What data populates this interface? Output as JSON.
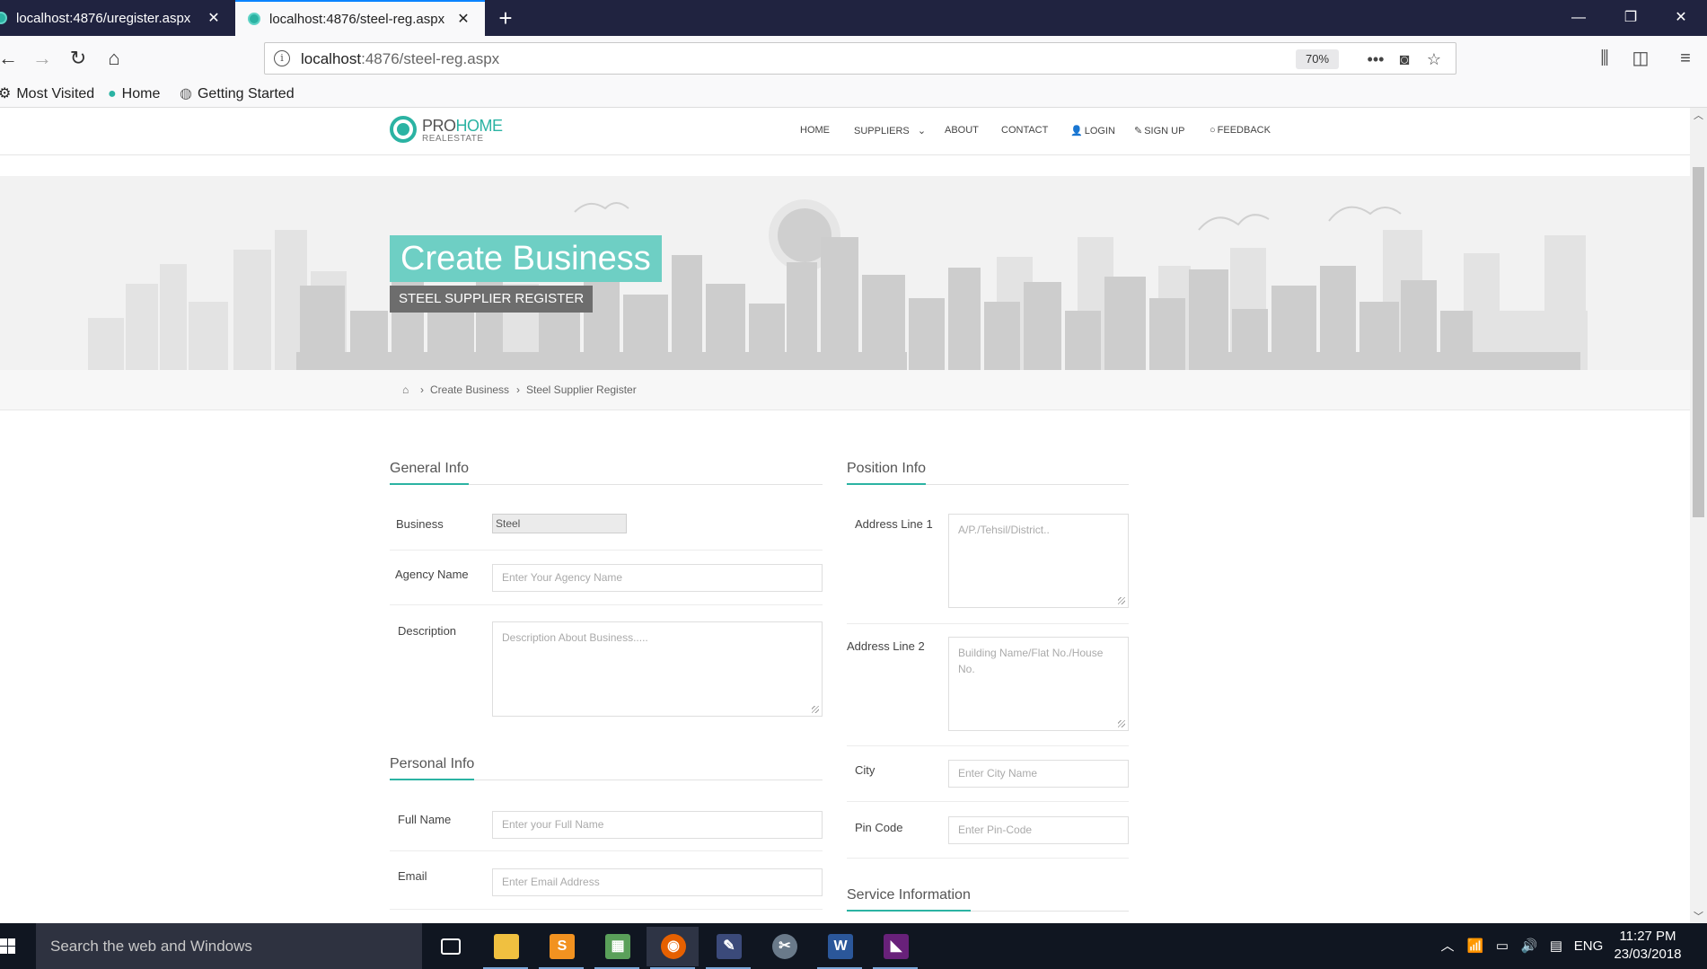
{
  "browser": {
    "tabs": [
      {
        "label": "localhost:4876/uregister.aspx",
        "active": false
      },
      {
        "label": "localhost:4876/steel-reg.aspx",
        "active": true
      }
    ],
    "url_host": "localhost",
    "url_path": ":4876/steel-reg.aspx",
    "zoom": "70%",
    "bookmarks": [
      "Most Visited",
      "Home",
      "Getting Started"
    ]
  },
  "site": {
    "logo_pro": "PRO",
    "logo_home": "HOME",
    "logo_sub": "REALESTATE",
    "menu": {
      "home": "HOME",
      "suppliers": "SUPPLIERS",
      "about": "ABOUT",
      "contact": "CONTACT",
      "login": "LOGIN",
      "signup": "SIGN UP",
      "feedback": "FEEDBACK"
    }
  },
  "hero": {
    "title": "Create Business",
    "subtitle": "STEEL SUPPLIER REGISTER"
  },
  "breadcrumb": {
    "items": [
      "Create Business",
      "Steel Supplier Register"
    ]
  },
  "form": {
    "general": {
      "title": "General Info",
      "business_label": "Business",
      "business_value": "Steel",
      "agency_label": "Agency Name",
      "agency_placeholder": "Enter Your Agency Name",
      "description_label": "Description",
      "description_placeholder": "Description About Business....."
    },
    "personal": {
      "title": "Personal Info",
      "fullname_label": "Full Name",
      "fullname_placeholder": "Enter your Full Name",
      "email_label": "Email",
      "email_placeholder": "Enter Email Address"
    },
    "position": {
      "title": "Position Info",
      "address1_label": "Address Line 1",
      "address1_placeholder": "A/P./Tehsil/District..",
      "address2_label": "Address Line 2",
      "address2_placeholder": "Building Name/Flat No./House No.",
      "city_label": "City",
      "city_placeholder": "Enter City Name",
      "pincode_label": "Pin Code",
      "pincode_placeholder": "Enter Pin-Code"
    },
    "service": {
      "title": "Service Information"
    }
  },
  "taskbar": {
    "search_placeholder": "Search the web and Windows",
    "language": "ENG",
    "time": "11:27 PM",
    "date": "23/03/2018"
  },
  "colors": {
    "accent": "#2bb3a3",
    "hero_title_bg": "#6ecfc4",
    "tabbar": "#202340"
  }
}
